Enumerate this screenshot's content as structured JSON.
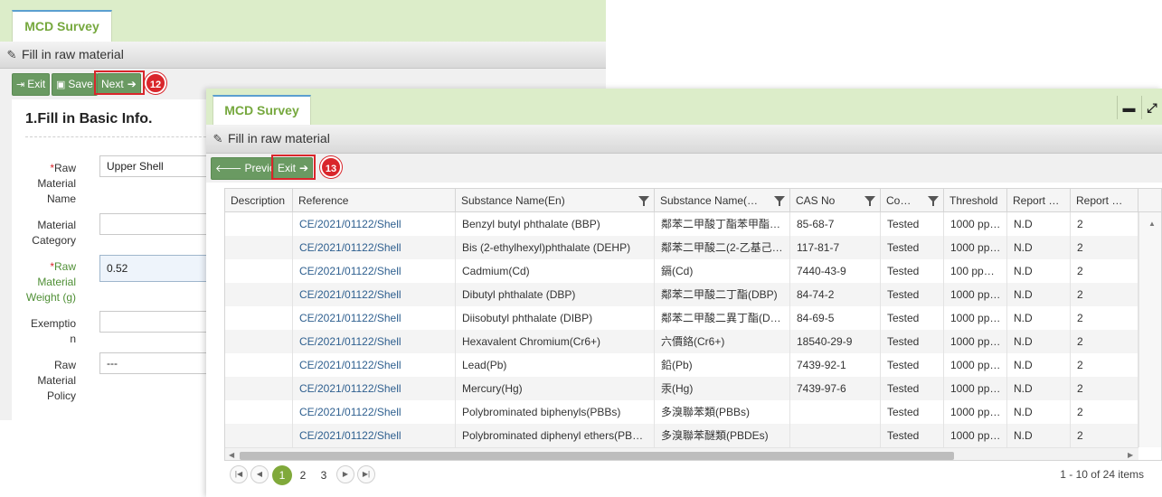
{
  "back_window": {
    "tab_label": "MCD Survey",
    "title": "Fill in raw material",
    "toolbar": {
      "exit_label": "Exit",
      "save_label": "Save",
      "next_label": "Next"
    },
    "step_badge": "12",
    "section_title": "1.Fill in Basic Info.",
    "fields": {
      "raw_material_name": {
        "label_line1": "Raw",
        "label_line2": "Material",
        "label_line3": "Name",
        "value": "Upper Shell"
      },
      "material_category": {
        "label_line1": "Material",
        "label_line2": "Category",
        "value": ""
      },
      "raw_material_weight": {
        "label_line1": "Raw",
        "label_line2": "Material",
        "label_line3": "Weight (g)",
        "value": "0.52"
      },
      "exemption": {
        "label_line1": "Exemptio",
        "label_line2": "n",
        "value": ""
      },
      "raw_material_policy": {
        "label_line1": "Raw",
        "label_line2": "Material",
        "label_line3": "Policy",
        "value": "---"
      }
    },
    "required_mark": "*"
  },
  "front_window": {
    "tab_label": "MCD Survey",
    "title": "Fill in raw material",
    "toolbar": {
      "previous_label": "Previous",
      "exit_label": "Exit"
    },
    "step_badge": "13",
    "window_controls": {
      "minimize": "▬",
      "maximize": "⤢"
    },
    "grid": {
      "columns": [
        "Description",
        "Reference",
        "Substance Name(En)",
        "Substance Name(…",
        "CAS No",
        "Co…",
        "Threshold",
        "Report …",
        "Report …"
      ],
      "rows": [
        {
          "description": "",
          "reference": "CE/2021/01122/Shell",
          "name_en": "Benzyl butyl phthalate (BBP)",
          "name_zh": "鄰苯二甲酸丁酯苯甲酯…",
          "cas": "85-68-7",
          "status": "Tested",
          "threshold": "1000 pp…",
          "report1": "N.D",
          "report2": "2"
        },
        {
          "description": "",
          "reference": "CE/2021/01122/Shell",
          "name_en": "Bis (2-ethylhexyl)phthalate (DEHP)",
          "name_zh": "鄰苯二甲酸二(2-乙基己…",
          "cas": "117-81-7",
          "status": "Tested",
          "threshold": "1000 pp…",
          "report1": "N.D",
          "report2": "2"
        },
        {
          "description": "",
          "reference": "CE/2021/01122/Shell",
          "name_en": "Cadmium(Cd)",
          "name_zh": "鎘(Cd)",
          "cas": "7440-43-9",
          "status": "Tested",
          "threshold": "100 pp…",
          "report1": "N.D",
          "report2": "2"
        },
        {
          "description": "",
          "reference": "CE/2021/01122/Shell",
          "name_en": "Dibutyl phthalate (DBP)",
          "name_zh": "鄰苯二甲酸二丁酯(DBP)",
          "cas": "84-74-2",
          "status": "Tested",
          "threshold": "1000 pp…",
          "report1": "N.D",
          "report2": "2"
        },
        {
          "description": "",
          "reference": "CE/2021/01122/Shell",
          "name_en": "Diisobutyl phthalate (DIBP)",
          "name_zh": "鄰苯二甲酸二異丁酯(D…",
          "cas": "84-69-5",
          "status": "Tested",
          "threshold": "1000 pp…",
          "report1": "N.D",
          "report2": "2"
        },
        {
          "description": "",
          "reference": "CE/2021/01122/Shell",
          "name_en": "Hexavalent Chromium(Cr6+)",
          "name_zh": "六價鉻(Cr6+)",
          "cas": "18540-29-9",
          "status": "Tested",
          "threshold": "1000 pp…",
          "report1": "N.D",
          "report2": "2"
        },
        {
          "description": "",
          "reference": "CE/2021/01122/Shell",
          "name_en": "Lead(Pb)",
          "name_zh": "鉛(Pb)",
          "cas": "7439-92-1",
          "status": "Tested",
          "threshold": "1000 pp…",
          "report1": "N.D",
          "report2": "2"
        },
        {
          "description": "",
          "reference": "CE/2021/01122/Shell",
          "name_en": "Mercury(Hg)",
          "name_zh": "汞(Hg)",
          "cas": "7439-97-6",
          "status": "Tested",
          "threshold": "1000 pp…",
          "report1": "N.D",
          "report2": "2"
        },
        {
          "description": "",
          "reference": "CE/2021/01122/Shell",
          "name_en": "Polybrominated biphenyls(PBBs)",
          "name_zh": "多溴聯苯類(PBBs)",
          "cas": "",
          "status": "Tested",
          "threshold": "1000 pp…",
          "report1": "N.D",
          "report2": "2"
        },
        {
          "description": "",
          "reference": "CE/2021/01122/Shell",
          "name_en": "Polybrominated diphenyl ethers(PB…",
          "name_zh": "多溴聯苯醚類(PBDEs)",
          "cas": "",
          "status": "Tested",
          "threshold": "1000 pp…",
          "report1": "N.D",
          "report2": "2"
        }
      ]
    },
    "pager": {
      "pages": [
        "1",
        "2",
        "3"
      ],
      "current_page": "1",
      "info": "1 - 10 of 24 items"
    }
  },
  "colors": {
    "tab_text": "#76a83e",
    "button": "#6a9a62",
    "highlight_box": "#d9262b",
    "link": "#2e5f8f",
    "active_page": "#80a93a"
  },
  "icons": [
    "edit-icon",
    "exit-icon",
    "save-icon",
    "arrow-right-icon",
    "arrow-left-icon",
    "filter-icon",
    "minimize-icon",
    "maximize-icon",
    "first-page-icon",
    "prev-page-icon",
    "next-page-icon",
    "last-page-icon"
  ]
}
